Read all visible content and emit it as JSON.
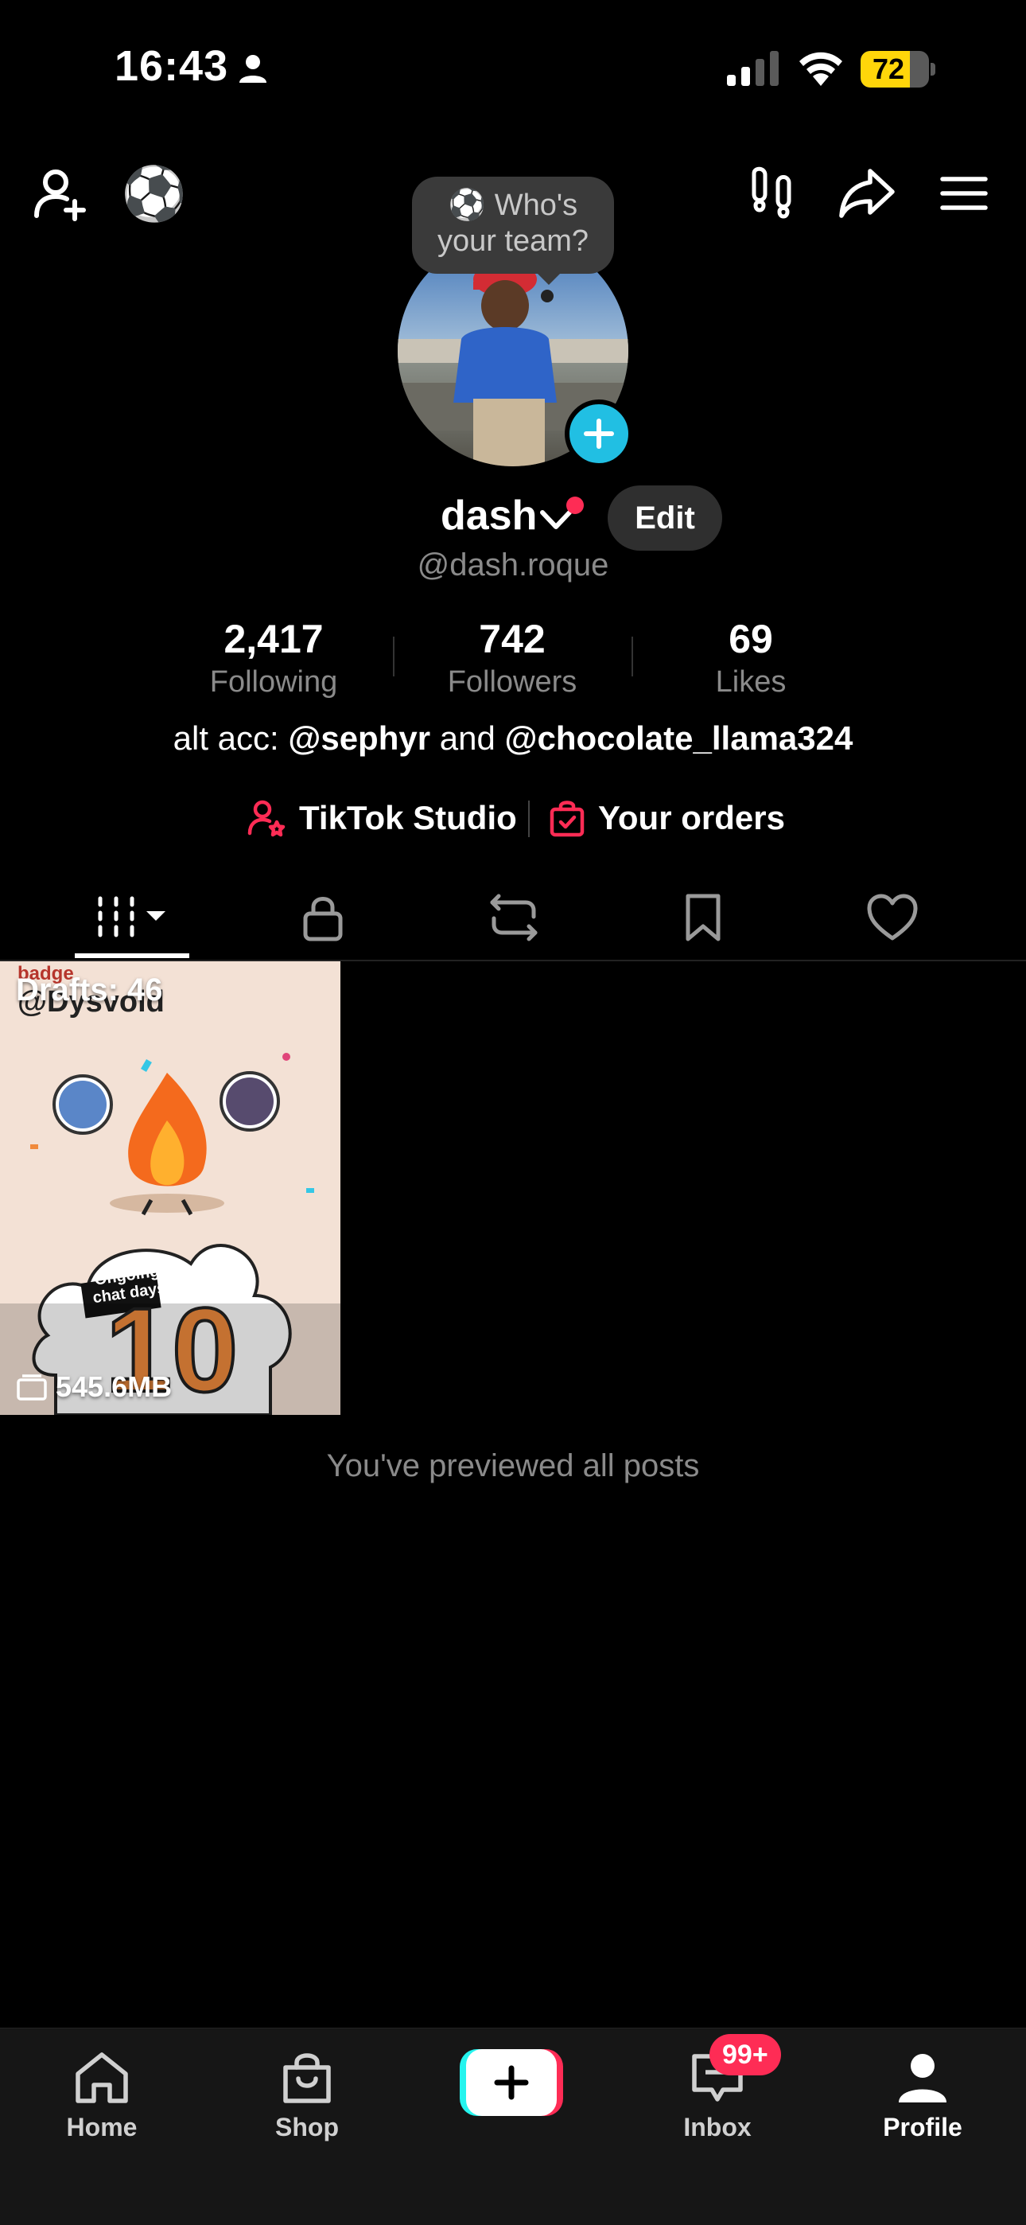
{
  "status_bar": {
    "time": "16:43",
    "battery": "72",
    "battery_level": 0.72
  },
  "top_nav": {
    "football_emoji": "⚽"
  },
  "bubble": {
    "emoji": "⚽",
    "line1": "Who's",
    "line2": "your team?"
  },
  "profile": {
    "name": "dash",
    "edit_label": "Edit",
    "handle": "@dash.roque",
    "stats": [
      {
        "value": "2,417",
        "label": "Following"
      },
      {
        "value": "742",
        "label": "Followers"
      },
      {
        "value": "69",
        "label": "Likes"
      }
    ],
    "bio": {
      "prefix": "alt acc: ",
      "mention1": "@sephyr",
      "joiner": " and ",
      "mention2": "@chocolate_llama324"
    },
    "links": [
      {
        "label": "TikTok Studio"
      },
      {
        "label": "Your orders"
      }
    ]
  },
  "draft": {
    "label": "Drafts: 46",
    "size": "545.6MB",
    "badge": "badge",
    "handle": "@Dysvold",
    "sticker_line1": "Ongoing",
    "sticker_line2": "chat days",
    "number": "10"
  },
  "end_message": "You've previewed all posts",
  "bottom_nav": {
    "items": [
      {
        "label": "Home"
      },
      {
        "label": "Shop"
      },
      {
        "label": "Inbox"
      },
      {
        "label": "Profile"
      }
    ],
    "inbox_badge": "99+"
  },
  "colors": {
    "accent_pink": "#fe2c55",
    "accent_cyan": "#25f4ee",
    "plus_blue": "#21bfe3",
    "battery_yellow": "#ffd60a"
  }
}
